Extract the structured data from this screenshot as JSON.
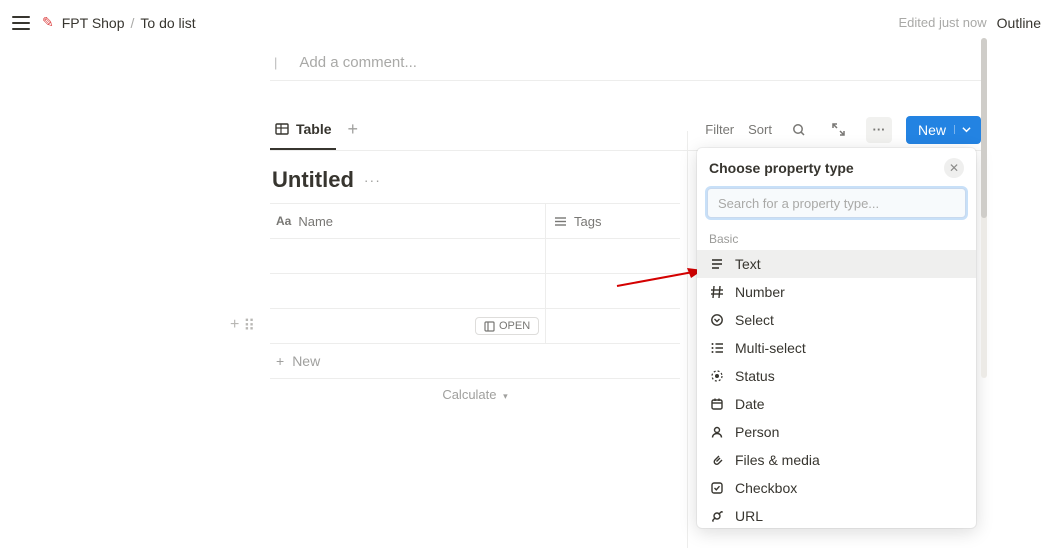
{
  "breadcrumb": {
    "workspace": "FPT Shop",
    "page": "To do list",
    "sep": "/"
  },
  "header": {
    "edited": "Edited just now",
    "outline": "Outline"
  },
  "comment": {
    "placeholder": "Add a comment..."
  },
  "tabs": {
    "active": "Table",
    "filter": "Filter",
    "sort": "Sort",
    "new": "New"
  },
  "db": {
    "title": "Untitled",
    "new_row": "New",
    "calculate": "Calculate"
  },
  "columns": {
    "name": "Name",
    "tags": "Tags"
  },
  "row": {
    "open": "OPEN"
  },
  "popover": {
    "title": "Choose property type",
    "search_placeholder": "Search for a property type...",
    "section_basic": "Basic",
    "items": [
      {
        "label": "Text",
        "icon": "text"
      },
      {
        "label": "Number",
        "icon": "number"
      },
      {
        "label": "Select",
        "icon": "select"
      },
      {
        "label": "Multi-select",
        "icon": "multiselect"
      },
      {
        "label": "Status",
        "icon": "status"
      },
      {
        "label": "Date",
        "icon": "date"
      },
      {
        "label": "Person",
        "icon": "person"
      },
      {
        "label": "Files & media",
        "icon": "files"
      },
      {
        "label": "Checkbox",
        "icon": "checkbox"
      },
      {
        "label": "URL",
        "icon": "url"
      }
    ],
    "highlighted": 0
  }
}
